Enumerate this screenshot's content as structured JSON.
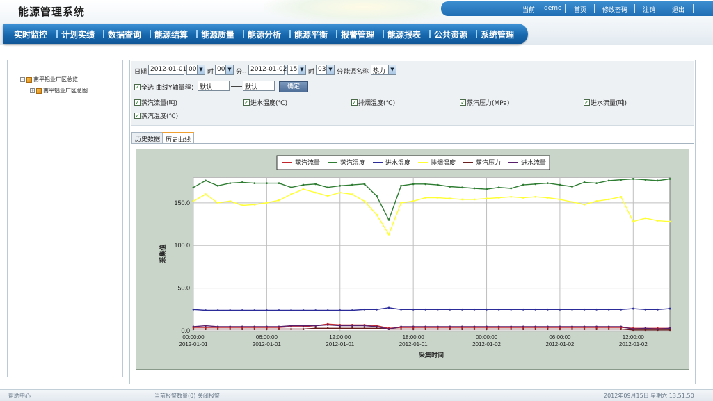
{
  "app": {
    "title": "能源管理系统"
  },
  "topbar": {
    "current_label": "当前:",
    "user": "demo",
    "links": [
      "首页",
      "修改密码",
      "注销",
      "退出"
    ]
  },
  "nav": [
    "实时监控",
    "计划实绩",
    "数据查询",
    "能源结算",
    "能源质量",
    "能源分析",
    "能源平衡",
    "报警管理",
    "能源报表",
    "公共资源",
    "系统管理"
  ],
  "tree": {
    "root": "南平铝业厂区总览",
    "child": "南平铝业厂区总图"
  },
  "filter": {
    "date_label": "日期",
    "start_date": "2012-01-01",
    "start_hour": "00",
    "hour_label": "时",
    "start_min": "00",
    "min_label": "分--",
    "end_date": "2012-01-02",
    "end_hour": "15",
    "end_min": "03",
    "end_min_label": "分",
    "energy_label": "能源名称",
    "energy_value": "热力",
    "select_all": "全选",
    "y_range_label": "曲线Y轴量程：",
    "y_min": "默认",
    "y_max": "默认",
    "confirm": "确定",
    "checks": [
      "蒸汽流量(吨)",
      "进水温度(℃)",
      "排烟温度(℃)",
      "蒸汽压力(MPa)",
      "进水流量(吨)",
      "蒸汽温度(℃)"
    ]
  },
  "tabs": [
    "历史数据",
    "历史曲线"
  ],
  "chart_data": {
    "type": "line",
    "ylabel": "采集值",
    "xlabel": "采集时间",
    "ylim": [
      0,
      180
    ],
    "yticks": [
      "0.0",
      "50.0",
      "100.0",
      "150.0"
    ],
    "xticks": [
      [
        "00:00:00",
        "2012-01-01"
      ],
      [
        "06:00:00",
        "2012-01-01"
      ],
      [
        "12:00:00",
        "2012-01-01"
      ],
      [
        "18:00:00",
        "2012-01-01"
      ],
      [
        "00:00:00",
        "2012-01-02"
      ],
      [
        "06:00:00",
        "2012-01-02"
      ],
      [
        "12:00:00",
        "2012-01-02"
      ]
    ],
    "x_hours": [
      0,
      1,
      2,
      3,
      4,
      5,
      6,
      7,
      8,
      9,
      10,
      11,
      12,
      13,
      14,
      15,
      16,
      17,
      18,
      19,
      20,
      21,
      22,
      23,
      24,
      25,
      26,
      27,
      28,
      29,
      30,
      31,
      32,
      33,
      34,
      35,
      36,
      37,
      38,
      39
    ],
    "series": [
      {
        "name": "蒸汽流量",
        "color": "#c0262c",
        "values": [
          4,
          4,
          4,
          4,
          4,
          4,
          4,
          4,
          5,
          5,
          6,
          8,
          7,
          7,
          7,
          6,
          3,
          4,
          4,
          4,
          4,
          4,
          4,
          4,
          4,
          4,
          4,
          4,
          4,
          4,
          4,
          4,
          4,
          4,
          4,
          4,
          3,
          3,
          3,
          3
        ]
      },
      {
        "name": "蒸汽温度",
        "color": "#2e7d32",
        "values": [
          168,
          176,
          170,
          173,
          174,
          173,
          173,
          173,
          168,
          171,
          172,
          168,
          170,
          171,
          172,
          158,
          130,
          170,
          172,
          172,
          171,
          169,
          168,
          167,
          166,
          168,
          167,
          171,
          172,
          173,
          171,
          169,
          174,
          173,
          176,
          177,
          178,
          177,
          176,
          178
        ]
      },
      {
        "name": "进水温度",
        "color": "#2b2b9a",
        "values": [
          25,
          24,
          24,
          24,
          24,
          24,
          24,
          24,
          24,
          24,
          24,
          24,
          24,
          24,
          25,
          25,
          27,
          25,
          25,
          25,
          25,
          25,
          25,
          25,
          25,
          25,
          25,
          25,
          25,
          25,
          25,
          25,
          25,
          25,
          25,
          25,
          26,
          25,
          25,
          26
        ]
      },
      {
        "name": "排烟温度",
        "color": "#ffff33",
        "values": [
          152,
          160,
          150,
          152,
          147,
          148,
          150,
          153,
          160,
          166,
          162,
          158,
          162,
          160,
          152,
          136,
          113,
          150,
          152,
          156,
          156,
          155,
          154,
          154,
          155,
          156,
          157,
          156,
          157,
          156,
          154,
          151,
          148,
          152,
          154,
          157,
          128,
          132,
          129,
          128
        ]
      },
      {
        "name": "蒸汽压力",
        "color": "#6a1f1f",
        "values": [
          2,
          2,
          2,
          2,
          2,
          2,
          2,
          2,
          2,
          2,
          3,
          3,
          3,
          3,
          3,
          3,
          2,
          2,
          2,
          2,
          2,
          2,
          2,
          2,
          2,
          2,
          2,
          2,
          2,
          2,
          2,
          2,
          2,
          2,
          2,
          2,
          1,
          1,
          1,
          1
        ]
      },
      {
        "name": "进水流量",
        "color": "#5a1f6a",
        "values": [
          5,
          6,
          5,
          5,
          5,
          5,
          5,
          5,
          6,
          6,
          6,
          7,
          6,
          6,
          6,
          5,
          2,
          5,
          5,
          5,
          5,
          5,
          5,
          5,
          5,
          5,
          5,
          5,
          5,
          5,
          5,
          5,
          5,
          5,
          5,
          5,
          2,
          3,
          2,
          3
        ]
      }
    ]
  },
  "footer": {
    "help": "帮助中心",
    "alarm": "当前报警数量(0)  关闭报警",
    "datetime": "2012年09月15日  星期六  13:51:50"
  }
}
